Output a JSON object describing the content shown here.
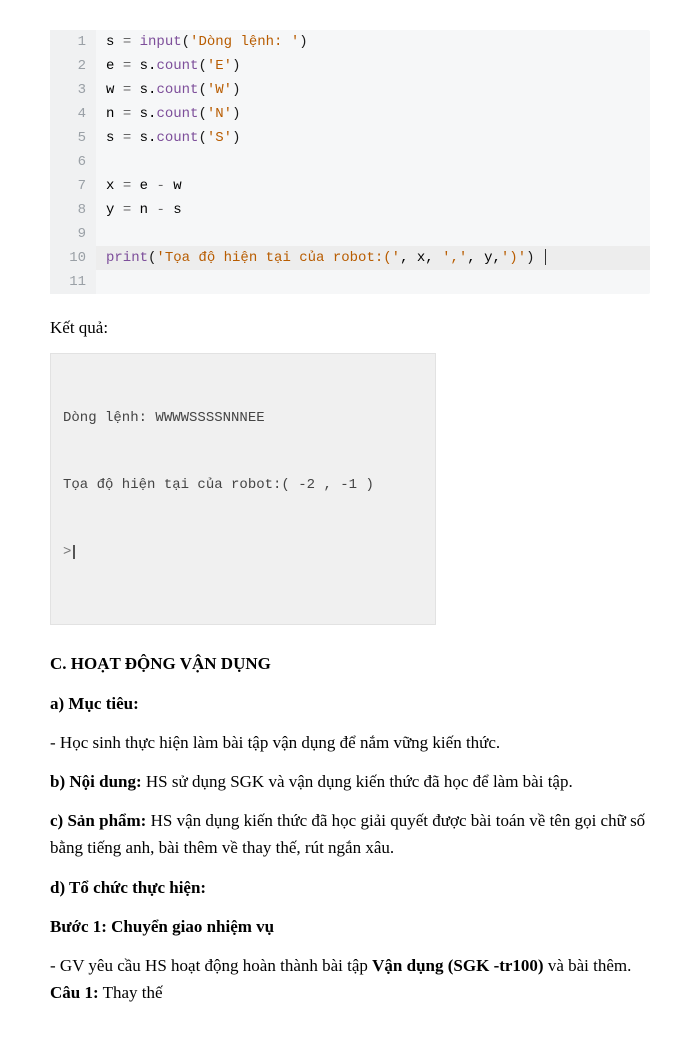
{
  "code": {
    "lines": [
      {
        "n": "1",
        "html": "s <span class='tok-op'>=</span> <span class='tok-fn'>input</span><span class='tok-paren'>(</span><span class='tok-str'>'Dòng lệnh: '</span><span class='tok-paren'>)</span>"
      },
      {
        "n": "2",
        "html": "e <span class='tok-op'>=</span> s.<span class='tok-fn'>count</span><span class='tok-paren'>(</span><span class='tok-str'>'E'</span><span class='tok-paren'>)</span>"
      },
      {
        "n": "3",
        "html": "w <span class='tok-op'>=</span> s.<span class='tok-fn'>count</span><span class='tok-paren'>(</span><span class='tok-str'>'W'</span><span class='tok-paren'>)</span>"
      },
      {
        "n": "4",
        "html": "n <span class='tok-op'>=</span> s.<span class='tok-fn'>count</span><span class='tok-paren'>(</span><span class='tok-str'>'N'</span><span class='tok-paren'>)</span>"
      },
      {
        "n": "5",
        "html": "s <span class='tok-op'>=</span> s.<span class='tok-fn'>count</span><span class='tok-paren'>(</span><span class='tok-str'>'S'</span><span class='tok-paren'>)</span>"
      },
      {
        "n": "6",
        "html": ""
      },
      {
        "n": "7",
        "html": "x <span class='tok-op'>=</span> e <span class='tok-op'>-</span> w"
      },
      {
        "n": "8",
        "html": "y <span class='tok-op'>=</span> n <span class='tok-op'>-</span> s"
      },
      {
        "n": "9",
        "html": ""
      },
      {
        "n": "10",
        "html": "<span class='tok-fn'>print</span><span class='tok-paren'>(</span><span class='tok-str'>'Tọa độ hiện tại của robot:('</span>, x, <span class='tok-str'>','</span>, y,<span class='tok-str'>')'</span><span class='tok-paren'>)</span>",
        "hl": true,
        "cursor": true
      },
      {
        "n": "11",
        "html": ""
      }
    ]
  },
  "result_label": "Kết quả:",
  "output": {
    "line1": "Dòng lệnh: WWWWSSSSNNNEE",
    "line2": "Tọa độ hiện tại của robot:( -2 , -1 )",
    "prompt": ">"
  },
  "doc": {
    "section_c": "C. HOẠT ĐỘNG VẬN DỤNG",
    "a_label": "a) Mục tiêu:",
    "a_text": "- Học sinh thực hiện làm bài tập vận dụng để nắm vững kiến thức.",
    "b_label": "b) Nội dung:",
    "b_text": " HS sử dụng SGK và vận dụng kiến thức đã học để làm bài tập.",
    "c_label": "c) Sản phẩm:",
    "c_text": " HS vận dụng kiến thức đã học giải quyết được bài toán về tên gọi chữ số bằng tiếng anh, bài thêm về thay thế, rút ngắn xâu.",
    "d_label": "d) Tổ chức thực hiện:",
    "step1": "Bước 1: Chuyển giao nhiệm vụ",
    "task_line_pre": "- GV yêu cầu HS hoạt động hoàn thành bài tập ",
    "task_bold": "Vận dụng (SGK -tr100)",
    "task_line_post": " và bài thêm.",
    "cau1_label": "Câu 1:",
    "cau1_text": " Thay thế"
  }
}
